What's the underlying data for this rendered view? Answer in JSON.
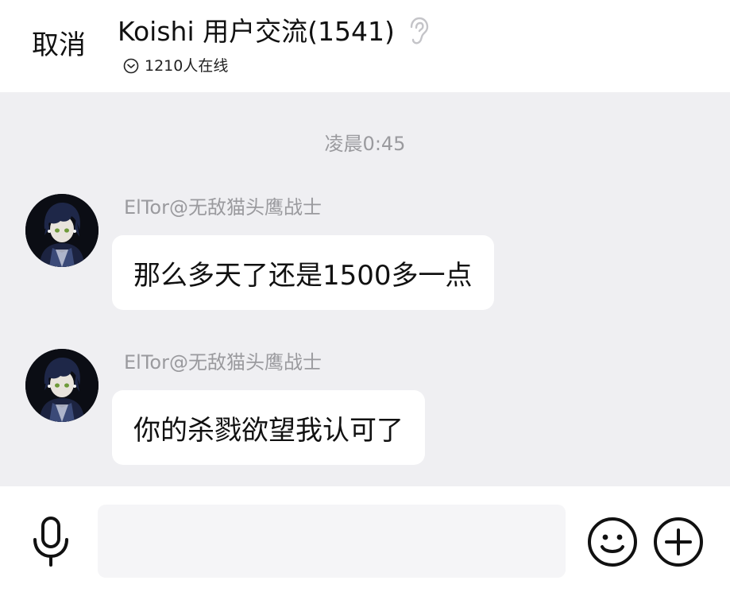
{
  "header": {
    "cancel_label": "取消",
    "title": "Koishi 用户交流(1541)",
    "online_text": "1210人在线",
    "icons": {
      "ear": "ear-icon",
      "online_toggle": "chevron-circle-icon"
    }
  },
  "messages": {
    "timestamp": "凌晨0:45",
    "items": [
      {
        "sender": "ElTor@无敌猫头鹰战士",
        "text": "那么多天了还是1500多一点"
      },
      {
        "sender": "ElTor@无敌猫头鹰战士",
        "text": "你的杀戮欲望我认可了"
      }
    ]
  },
  "input_bar": {
    "input_value": "",
    "icons": {
      "mic": "microphone-icon",
      "emoji": "emoji-icon",
      "plus": "plus-icon"
    }
  },
  "colors": {
    "message_background": "#efeff2",
    "bubble_background": "#ffffff",
    "meta_text": "#9a9a9e",
    "input_background": "#f5f5f7"
  }
}
